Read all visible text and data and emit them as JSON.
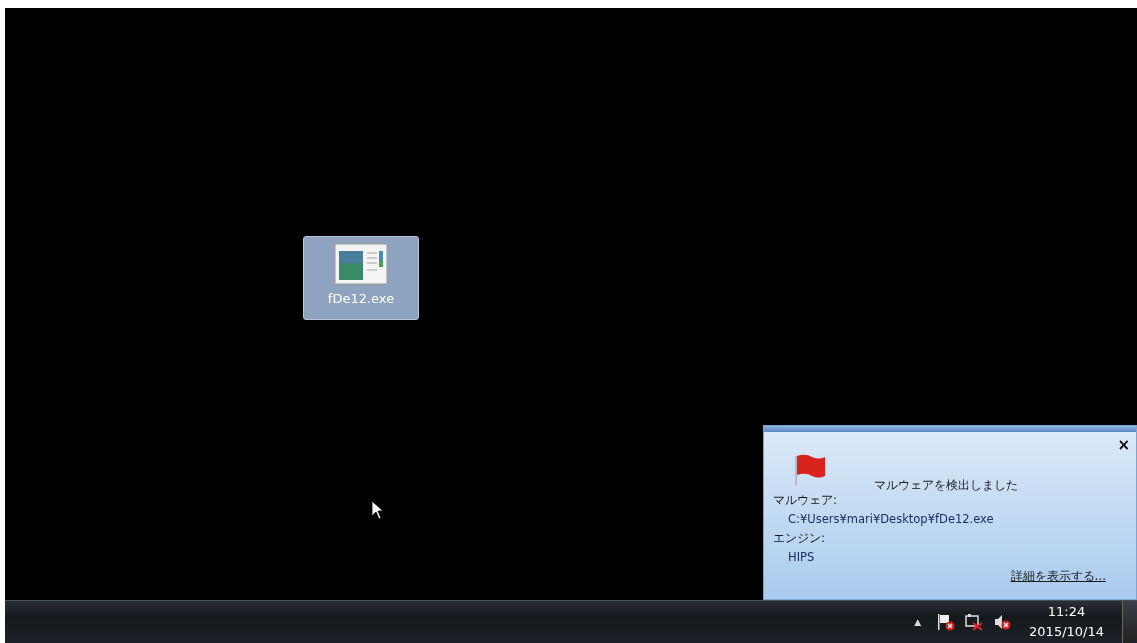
{
  "desktop_icons": [
    {
      "label": "fDe12.exe",
      "selected": true
    }
  ],
  "notification": {
    "title": "マルウェアを検出しました",
    "close": "×",
    "fields": [
      {
        "label": "マルウェア:",
        "value": "C:¥Users¥mari¥Desktop¥fDe12.exe"
      },
      {
        "label": "エンジン:",
        "value": "HIPS"
      }
    ],
    "link": "詳細を表示する..."
  },
  "taskbar": {
    "tray_toggle": "▲",
    "tray_icons": [
      {
        "kind": "flag"
      },
      {
        "kind": "network"
      },
      {
        "kind": "speaker"
      }
    ],
    "time": "11:24",
    "date": "2015/10/14"
  }
}
